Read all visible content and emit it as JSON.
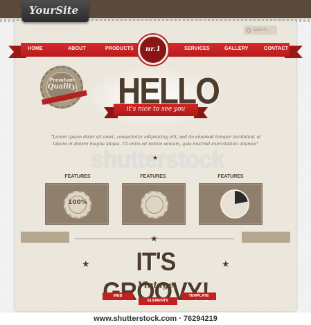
{
  "header": {
    "site_name": "YourSite",
    "search_placeholder": "search..."
  },
  "nav": {
    "items": [
      "HOME",
      "ABOUT",
      "PRODUCTS",
      "SERVICES",
      "GALLERY",
      "CONTACT"
    ],
    "badge": "nr.1"
  },
  "seal": {
    "line1": "Premium",
    "line2": "Quality",
    "ribbon": "BEST QUALITY"
  },
  "hero": {
    "title": "HELLO",
    "ribbon_text": "it's nice to see you",
    "lorem": "\"Lorem ipsum dolor sit amet, consectetur adipisicing elit, sed do eiusmod tempor incididunt ut labore et dolore magna aliqua. Ut enim ad minim veniam, quis nostrud exercitation ullamco\""
  },
  "watermark": "shutterstock",
  "features": {
    "labels": [
      "FEATURES",
      "FEATURES",
      "FEATURES"
    ],
    "badge_value": "100%"
  },
  "groovy": {
    "title": "IT'S GROOVY!",
    "subtitle": "Vintage",
    "ribbons": [
      "WEB",
      "ELEMENTS",
      "TEMPLATE"
    ]
  },
  "footer": {
    "url": "www.shutterstock.com · 76294219"
  },
  "colors": {
    "accent_red": "#c42020",
    "brown": "#4d3b2c",
    "paper": "#ece7dd"
  }
}
